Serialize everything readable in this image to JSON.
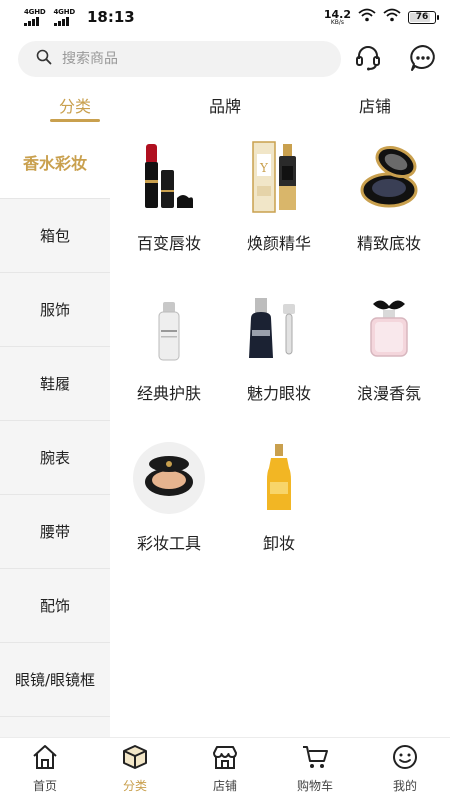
{
  "status_bar": {
    "net1": "4GHD",
    "net2": "4GHD",
    "time": "18:13",
    "speed_value": "14.2",
    "speed_unit": "KB/s",
    "battery": "76"
  },
  "search": {
    "placeholder": "搜索商品"
  },
  "top_tabs": [
    {
      "label": "分类",
      "active": true
    },
    {
      "label": "品牌",
      "active": false
    },
    {
      "label": "店铺",
      "active": false
    }
  ],
  "sidebar": {
    "items": [
      {
        "label": "香水彩妆",
        "active": true
      },
      {
        "label": "箱包"
      },
      {
        "label": "服饰"
      },
      {
        "label": "鞋履"
      },
      {
        "label": "腕表"
      },
      {
        "label": "腰带"
      },
      {
        "label": "配饰"
      },
      {
        "label": "眼镜/眼镜框"
      }
    ]
  },
  "products": [
    {
      "label": "百变唇妆",
      "icon": "lipstick-icon"
    },
    {
      "label": "焕颜精华",
      "icon": "serum-icon"
    },
    {
      "label": "精致底妆",
      "icon": "compact-icon"
    },
    {
      "label": "经典护肤",
      "icon": "skincare-bottle-icon"
    },
    {
      "label": "魅力眼妆",
      "icon": "eye-serum-icon"
    },
    {
      "label": "浪漫香氛",
      "icon": "perfume-icon"
    },
    {
      "label": "彩妆工具",
      "icon": "cushion-icon"
    },
    {
      "label": "卸妆",
      "icon": "cleansing-oil-icon"
    }
  ],
  "bottom_nav": [
    {
      "label": "首页",
      "icon": "home-icon"
    },
    {
      "label": "分类",
      "icon": "category-box-icon",
      "active": true
    },
    {
      "label": "店铺",
      "icon": "store-icon"
    },
    {
      "label": "购物车",
      "icon": "cart-icon"
    },
    {
      "label": "我的",
      "icon": "profile-icon"
    }
  ],
  "colors": {
    "accent": "#c9a04e",
    "sidebar_bg": "#f5f5f5",
    "search_bg": "#f2f2f2"
  }
}
